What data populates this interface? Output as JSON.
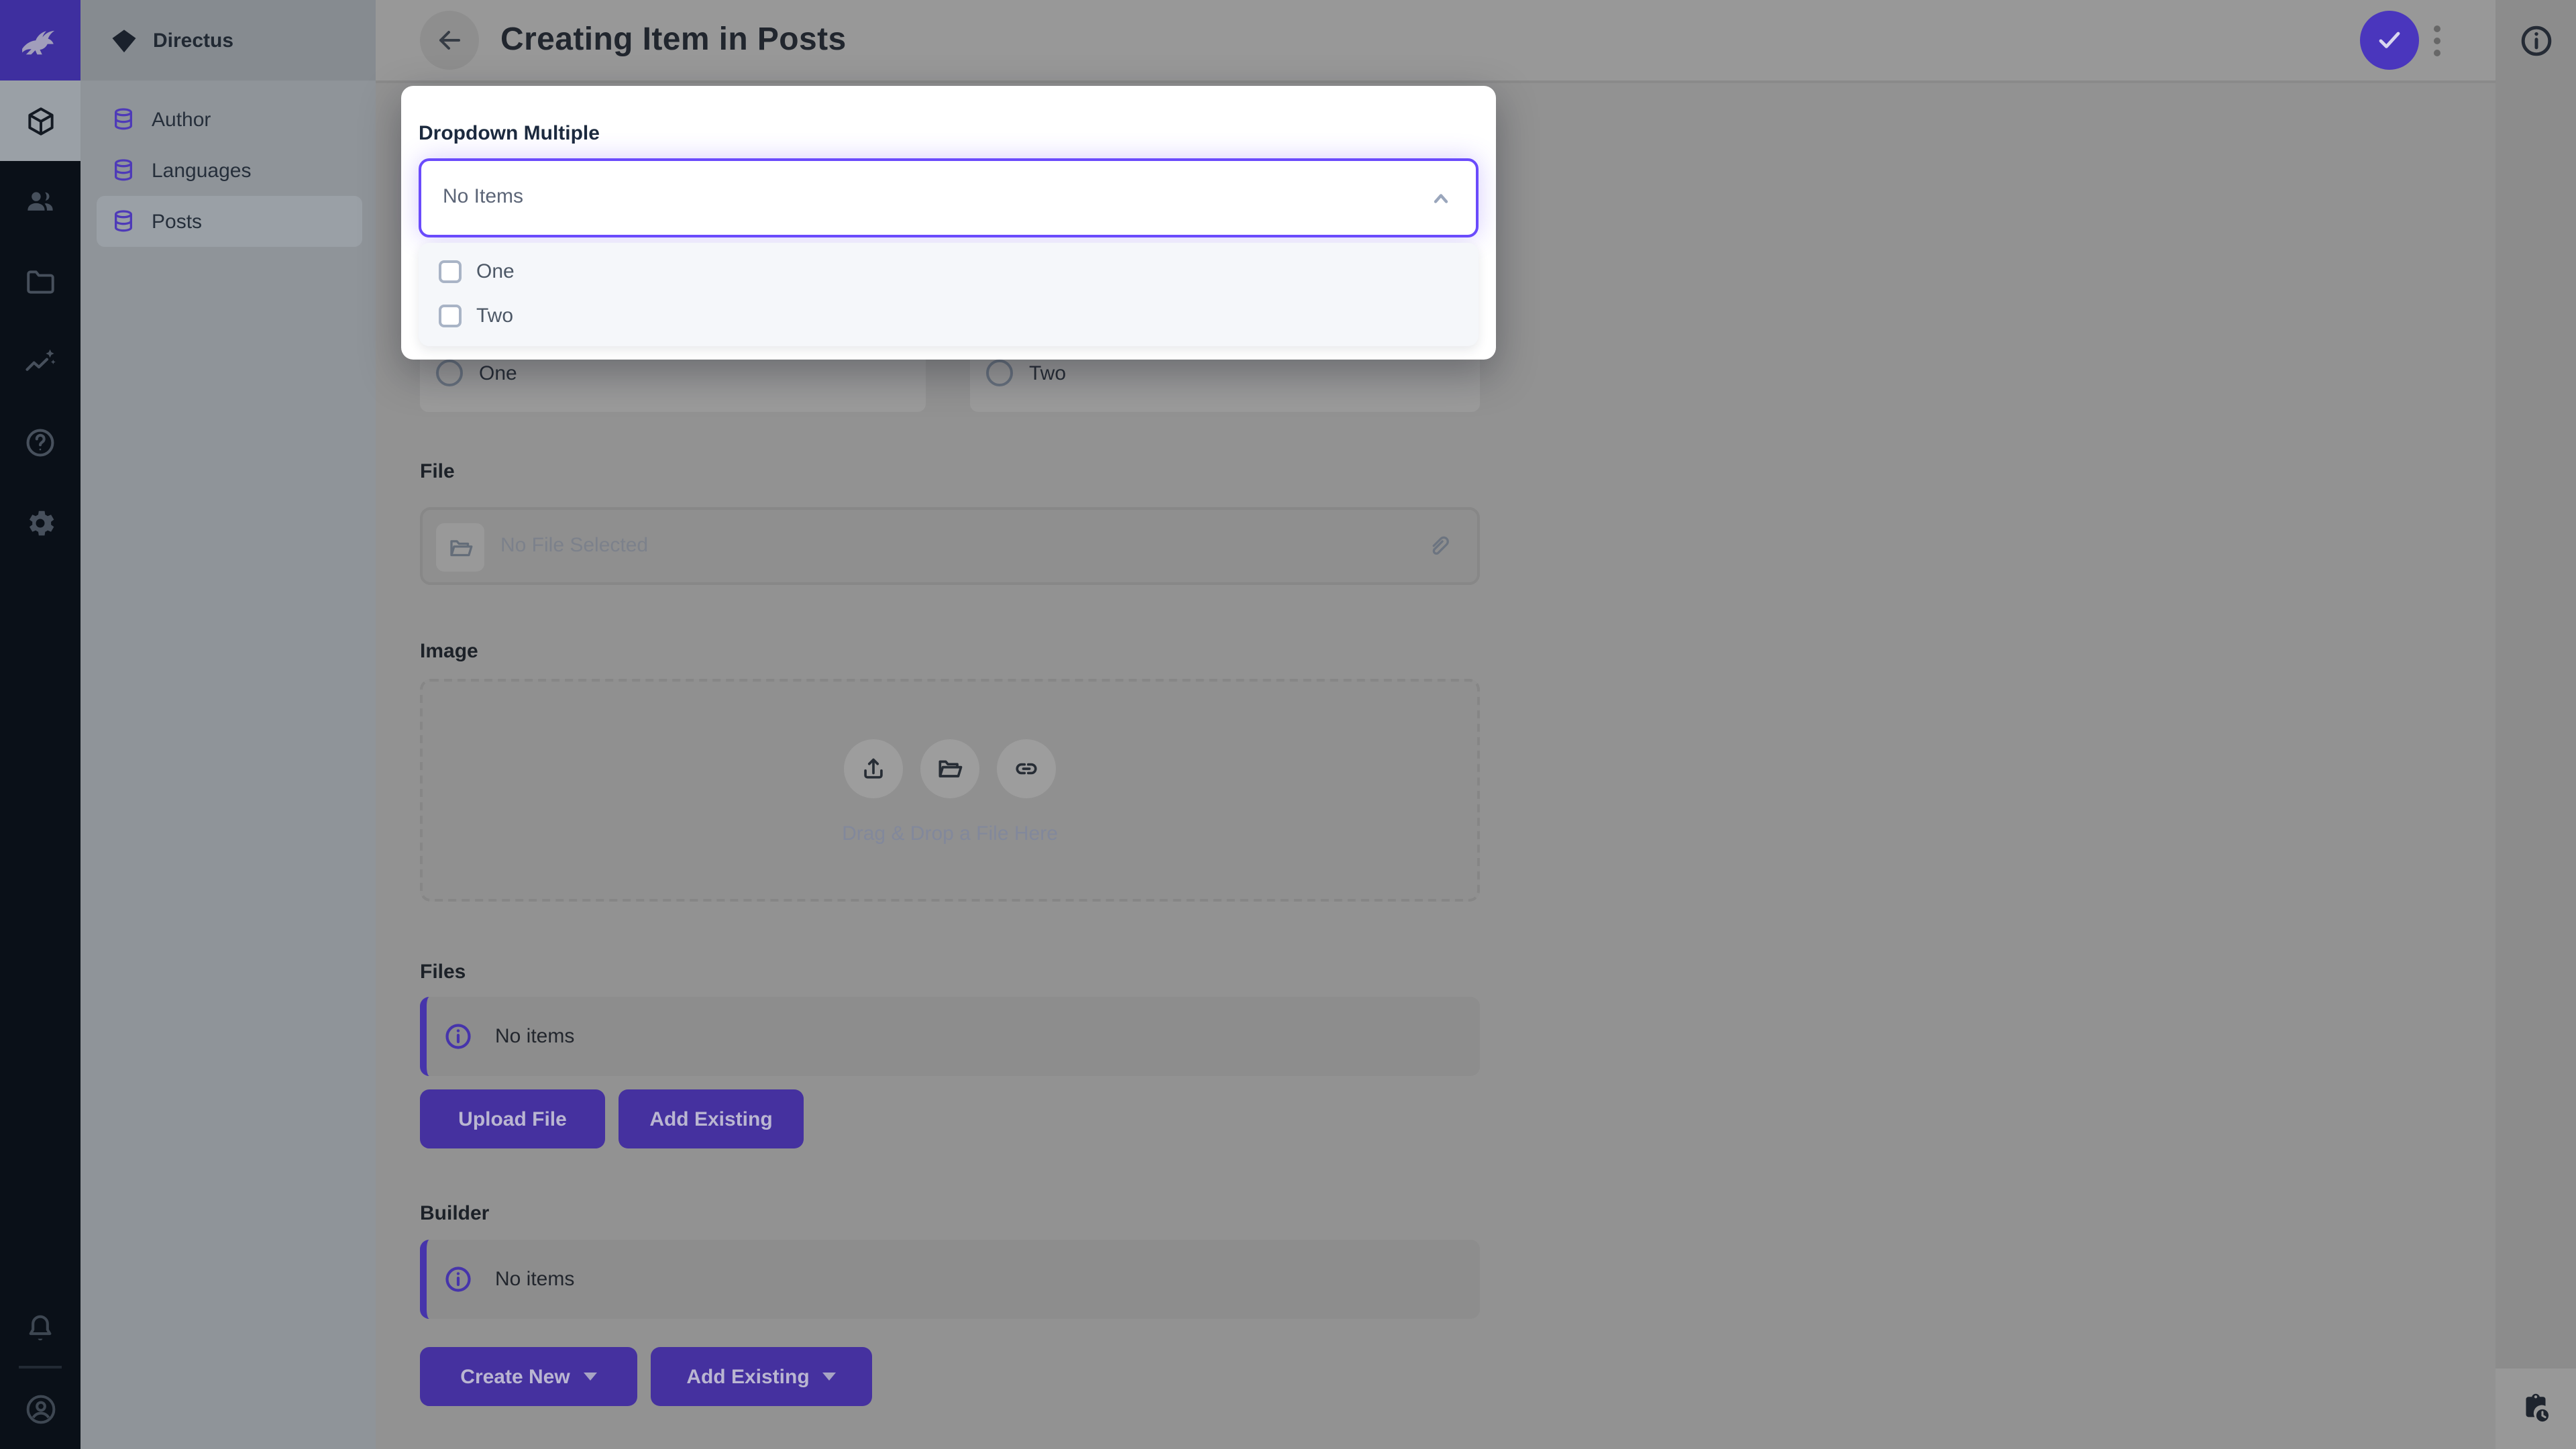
{
  "brand": {
    "accent_purple": "#6644FF",
    "dimmed_purple": "#45319f",
    "focus_border": "#6a4bfc"
  },
  "nav": {
    "project_name": "Directus",
    "items": [
      {
        "label": "Author"
      },
      {
        "label": "Languages"
      },
      {
        "label": "Posts"
      }
    ],
    "active_item": "Posts"
  },
  "header": {
    "title": "Creating Item in Posts"
  },
  "popover": {
    "field_label": "Dropdown Multiple",
    "value": "No Items",
    "options": [
      {
        "label": "One",
        "checked": false
      },
      {
        "label": "Two",
        "checked": false
      }
    ]
  },
  "form": {
    "radio_left": {
      "label": "One",
      "selected": false
    },
    "radio_right": {
      "label": "Two",
      "selected": false
    },
    "file": {
      "label": "File",
      "placeholder": "No File Selected"
    },
    "image": {
      "label": "Image",
      "drop_text": "Drag & Drop a File Here"
    },
    "files": {
      "label": "Files",
      "empty_text": "No items",
      "btn_upload": "Upload File",
      "btn_add": "Add Existing"
    },
    "builder": {
      "label": "Builder",
      "empty_text": "No items",
      "btn_create": "Create New",
      "btn_add": "Add Existing"
    }
  },
  "icons": {
    "module_bar": [
      "rabbit-logo",
      "box",
      "people",
      "folder",
      "insights",
      "help",
      "settings",
      "bell",
      "user-circle"
    ],
    "header": [
      "arrow-left",
      "check",
      "kebab-menu",
      "info"
    ],
    "field": [
      "database",
      "chevron-up",
      "folder-open",
      "paperclip",
      "upload",
      "link",
      "clipboard-clock"
    ]
  }
}
